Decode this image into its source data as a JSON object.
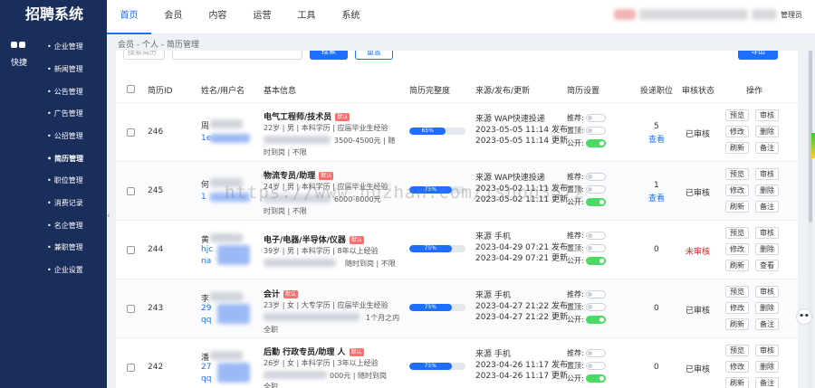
{
  "app": {
    "title": "招聘系统",
    "quick_label": "快捷",
    "user_role": "管理员"
  },
  "nav": [
    {
      "label": "首页",
      "active": true
    },
    {
      "label": "会员"
    },
    {
      "label": "内容"
    },
    {
      "label": "运营"
    },
    {
      "label": "工具"
    },
    {
      "label": "系统"
    }
  ],
  "sidebar": [
    {
      "label": "企业管理"
    },
    {
      "label": "新闻管理"
    },
    {
      "label": "公告管理"
    },
    {
      "label": "广告管理"
    },
    {
      "label": "公招管理"
    },
    {
      "label": "简历管理",
      "active": true
    },
    {
      "label": "职位管理"
    },
    {
      "label": "消费记录"
    },
    {
      "label": "名企管理"
    },
    {
      "label": "兼职管理"
    },
    {
      "label": "企业设置"
    }
  ],
  "breadcrumb": "会员 - 个人 - 简历管理",
  "filter": {
    "placeholder": "搜索简历",
    "search_label": "搜索",
    "reset_label": "重置",
    "export_label": "导出"
  },
  "table": {
    "headers": [
      "简历ID",
      "姓名/用户名",
      "基本信息",
      "简历完整度",
      "来源/发布/更新",
      "简历设置",
      "投递职位",
      "审核状态",
      "操作"
    ],
    "setting_labels": [
      "推荐:",
      "置顶:",
      "公开:"
    ],
    "rows": [
      {
        "id": "246",
        "name": "周",
        "username": "1e",
        "title": "电气工程师/技术员",
        "badge": "默认",
        "info1": "22岁 | 男 | 本科学历 | 应届毕业生经验",
        "info2": "3500-4500元 | 随",
        "info3": "时到岗 | 不限",
        "progress": 65,
        "progress_label": "65%",
        "source": "来源 WAP快速投递",
        "published": "2023-05-05 11:14 发布",
        "updated": "2023-05-05 11:14 更新",
        "applied": "5",
        "applied_link": "查看",
        "status": "已审核"
      },
      {
        "id": "245",
        "name": "何",
        "username": "1",
        "title": "物流专员/助理",
        "badge": "默认",
        "info1": "24岁 | 男 | 本科学历 | 应届毕业生经验",
        "info2": "6000-8000元",
        "info3": "时到岗 | 不限",
        "progress": 75,
        "progress_label": "75%",
        "source": "来源 WAP快速投递",
        "published": "2023-05-02 11:11 发布",
        "updated": "2023-05-02 11:11 更新",
        "applied": "1",
        "applied_link": "查看",
        "status": "已审核"
      },
      {
        "id": "244",
        "name": "黄",
        "username": "hjc",
        "title": "电子/电器/半导体/仪器",
        "badge": "默认",
        "info1": "39岁 | 男 | 本科学历 | 8年以上经验",
        "info2": "随时到岗 | 不限",
        "info3": "",
        "progress": 75,
        "progress_label": "75%",
        "source": "来源 手机",
        "published": "2023-04-29 07:21 发布",
        "updated": "2023-04-29 07:21 更新",
        "applied": "0",
        "applied_link": "",
        "status": "未审核"
      },
      {
        "id": "243",
        "name": "李",
        "username": "29",
        "title": "会计",
        "badge": "默认",
        "info1": "23岁 | 女 | 大专学历 | 应届毕业生经验",
        "info2": "1个月之内",
        "info3": "全职",
        "progress": 75,
        "progress_label": "75%",
        "source": "来源 手机",
        "published": "2023-04-27 21:22 发布",
        "updated": "2023-04-27 21:22 更新",
        "applied": "0",
        "applied_link": "",
        "status": "已审核"
      },
      {
        "id": "242",
        "name": "潘",
        "username": "27",
        "title": "后勤 行政专员/助理 人",
        "badge": "默认",
        "info1": "26岁 | 女 | 本科学历 | 3年以上经验",
        "info2": "000元 | 随时到岗",
        "info3": "全职",
        "progress": 75,
        "progress_label": "75%",
        "source": "来源 手机",
        "published": "2023-04-26 11:17 发布",
        "updated": "2023-04-26 11:17 更新",
        "applied": "0",
        "applied_link": "",
        "status": "已审核"
      }
    ],
    "ops": [
      "预览",
      "审核",
      "修改",
      "删除",
      "刷新",
      "备注"
    ],
    "ops_alt": [
      "预览",
      "审核",
      "修改",
      "删除",
      "刷新",
      "查看"
    ]
  },
  "watermark": "https://www.huzhan.com/ishop3572",
  "colors": {
    "sidebar": "#1a2e5c",
    "accent": "#1e6fff",
    "toggle_on": "#4cd964",
    "badge": "#ff6b6b",
    "unreviewed": "#e02020"
  }
}
